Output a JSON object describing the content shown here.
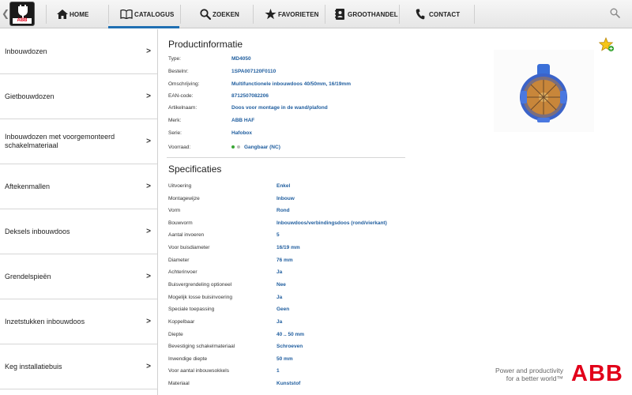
{
  "nav": {
    "items": [
      {
        "label": "HOME",
        "icon": "home-icon"
      },
      {
        "label": "CATALOGUS",
        "icon": "book-icon"
      },
      {
        "label": "ZOEKEN",
        "icon": "search-icon"
      },
      {
        "label": "FAVORIETEN",
        "icon": "star-icon"
      },
      {
        "label": "GROOTHANDEL",
        "icon": "address-book-icon"
      },
      {
        "label": "CONTACT",
        "icon": "phone-icon"
      }
    ],
    "active": "CATALOGUS",
    "accent_color": "#1f6fb2"
  },
  "app_logo": {
    "brand": "ABB"
  },
  "sidebar": {
    "items": [
      {
        "label": "Inbouwdozen"
      },
      {
        "label": "Gietbouwdozen"
      },
      {
        "label": "Inbouwdozen met voorgemonteerd schakelmateriaal"
      },
      {
        "label": "Aftekenmallen"
      },
      {
        "label": "Deksels inbouwdoos"
      },
      {
        "label": "Grendelspieën"
      },
      {
        "label": "Inzetstukken inbouwdoos"
      },
      {
        "label": "Keg installatiebuis"
      }
    ],
    "chevron": ">"
  },
  "product_info": {
    "title": "Productinformatie",
    "rows": [
      {
        "key": "Type:",
        "value": "MD4050"
      },
      {
        "key": "Bestelnr:",
        "value": "1SPA007120F0110"
      },
      {
        "key": "Omschrijving:",
        "value": "Multifunctionele inbouwdoos 40/50mm, 16/19mm"
      },
      {
        "key": "EAN-code:",
        "value": "8712507082206"
      },
      {
        "key": "Artikelnaam:",
        "value": "Doos voor montage in de wand/plafond"
      },
      {
        "key": "Merk:",
        "value": "ABB HAF"
      },
      {
        "key": "Serie:",
        "value": "Hafobox"
      }
    ],
    "stock": {
      "key": "Voorraad:",
      "value": "Gangbaar (NC)"
    }
  },
  "specs": {
    "title": "Specificaties",
    "rows": [
      {
        "key": "Uitvoering",
        "value": "Enkel"
      },
      {
        "key": "Montagewijze",
        "value": "Inbouw"
      },
      {
        "key": "Vorm",
        "value": "Rond"
      },
      {
        "key": "Bouwvorm",
        "value": "Inbouwdoos/verbindingsdoos (rond/vierkant)"
      },
      {
        "key": "Aantal invoeren",
        "value": "5"
      },
      {
        "key": "Voor buisdiameter",
        "value": "16/19 mm"
      },
      {
        "key": "Diameter",
        "value": "76 mm"
      },
      {
        "key": "Achterinvoer",
        "value": "Ja"
      },
      {
        "key": "Buisvergrendeling optioneel",
        "value": "Nee"
      },
      {
        "key": "Mogelijk losse buisinvoering",
        "value": "Ja"
      },
      {
        "key": "Speciale toepassing",
        "value": "Geen"
      },
      {
        "key": "Koppelbaar",
        "value": "Ja"
      },
      {
        "key": "Diepte",
        "value": "40 .. 50 mm"
      },
      {
        "key": "Bevestiging schakelmateriaal",
        "value": "Schroeven"
      },
      {
        "key": "Inwendige diepte",
        "value": "50 mm"
      },
      {
        "key": "Voor aantal inbouwsokkels",
        "value": "1"
      },
      {
        "key": "Materiaal",
        "value": "Kunststof"
      }
    ]
  },
  "branding": {
    "tagline_line1": "Power and productivity",
    "tagline_line2": "for a better world™",
    "logo": "ABB",
    "logo_color": "#e2001a"
  }
}
